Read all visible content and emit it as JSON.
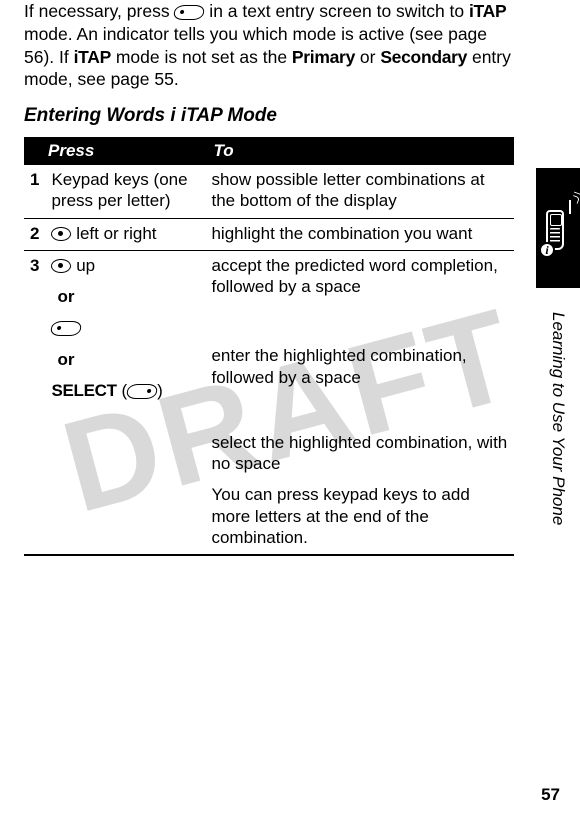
{
  "watermark": "DRAFT",
  "intro": {
    "pre": "If necessary, press ",
    "mid1": " in a text entry screen to switch to ",
    "mode": "iTAP",
    "mid2": " mode. An indicator tells you which mode is active (see page 56). If ",
    "mode2": "iTAP",
    "mid3": " mode is not set as the ",
    "primary": "Primary",
    "or": " or ",
    "secondary": "Secondary",
    "tail": " entry mode, see page 55."
  },
  "heading": "Entering Words i iTAP Mode",
  "header": {
    "press": "Press",
    "to": "To"
  },
  "rows": {
    "r1": {
      "num": "1",
      "press": "Keypad keys (one press per letter)",
      "to": "show possible letter combinations at the bottom of the display"
    },
    "r2": {
      "num": "2",
      "press": " left or right",
      "to": "highlight the combination you want"
    },
    "r3": {
      "num": "3",
      "press_a": " up",
      "to_a": "accept the predicted word completion, followed by a space",
      "or": "or",
      "to_b": "enter the highlighted combination, followed by a space",
      "select": "SELECT",
      "press_c_tail": ")",
      "press_c_open": " (",
      "to_c": "select the highlighted combination, with no space",
      "to_c2": "You can press keypad keys to add more letters at the end of the combination."
    }
  },
  "section": "Learning to Use Your Phone",
  "info_glyph": "i",
  "page_number": "57"
}
